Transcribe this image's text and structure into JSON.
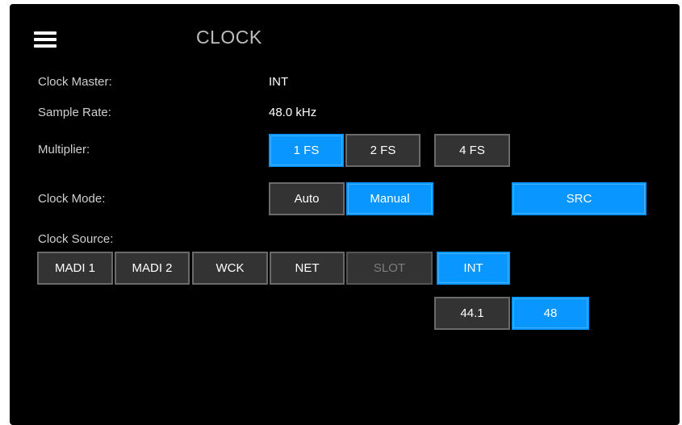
{
  "header": {
    "title": "CLOCK",
    "menu_icon": "hamburger-menu-icon"
  },
  "status": {
    "clock_master_label": "Clock Master:",
    "clock_master_value": "INT",
    "sample_rate_label": "Sample Rate:",
    "sample_rate_value": "48.0 kHz"
  },
  "multiplier": {
    "label": "Multiplier:",
    "options": [
      "1 FS",
      "2 FS",
      "4 FS"
    ],
    "selected": "1 FS"
  },
  "clock_mode": {
    "label": "Clock Mode:",
    "options": [
      "Auto",
      "Manual"
    ],
    "selected": "Manual",
    "src_label": "SRC",
    "src_active": true
  },
  "clock_source": {
    "label": "Clock Source:",
    "options": [
      "MADI 1",
      "MADI 2",
      "WCK",
      "NET",
      "SLOT",
      "INT"
    ],
    "selected": "INT",
    "disabled": [
      "SLOT"
    ]
  },
  "internal_rate": {
    "options": [
      "44.1",
      "48"
    ],
    "selected": "48"
  },
  "colors": {
    "background": "#000000",
    "button": "#333333",
    "button_border": "#6a6a6a",
    "active": "#0a96ff",
    "text": "#ffffff",
    "label": "#cfcfcf"
  }
}
